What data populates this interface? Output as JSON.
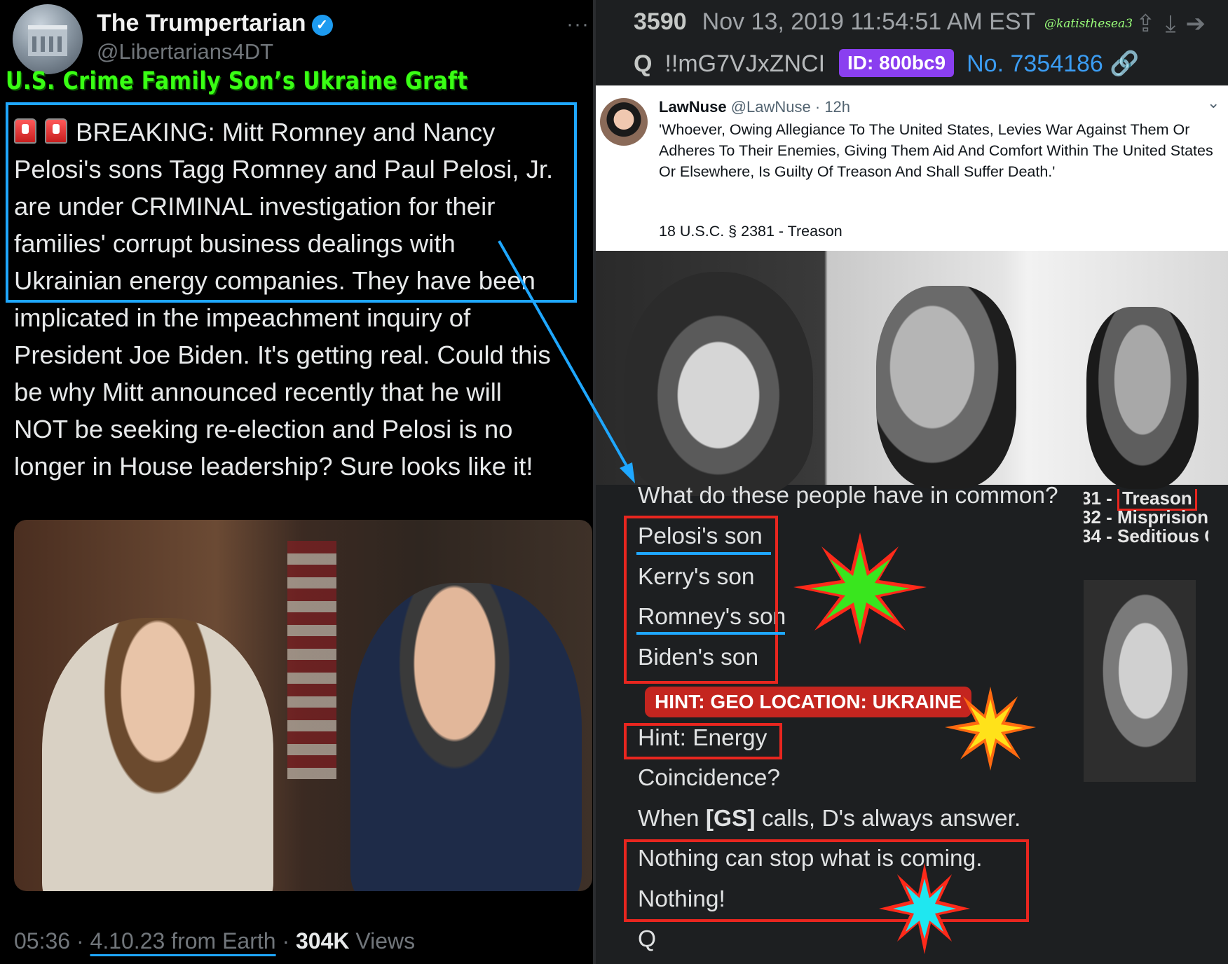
{
  "tweet": {
    "display_name": "The Trumpertarian",
    "verified_glyph": "✓",
    "handle": "@Libertarians4DT",
    "more_glyph": "···",
    "overlay_headline": "U.S. Crime Family Son’s Ukraine Graft",
    "body": "BREAKING: Mitt Romney and Nancy\nPelosi's sons Tagg Romney and Paul Pelosi, Jr.\nare under CRIMINAL investigation for their\nfamilies' corrupt business dealings with\nUkrainian energy companies. They have been\nimplicated in the impeachment inquiry of\nPresident Joe Biden. It's getting real. Could this\nbe why Mitt announced recently that he will\nNOT be seeking re-election and Pelosi is no\nlonger in House leadership? Sure looks like it!",
    "time": "05:36 · ",
    "date_source": "4.10.23 from Earth",
    "views_count": "304K",
    "views_label": " Views",
    "sep": " · "
  },
  "q_post": {
    "number": "3590",
    "timestamp": "Nov 13, 2019 11:54:51 AM EST",
    "watermark": "@katisthesea3",
    "icons": [
      "share-icon",
      "download-icon",
      "forward-icon"
    ],
    "icon_glyphs": "⇪⤓➔",
    "author": "Q",
    "tripcode": "!!mG7VJxZNCI",
    "id_badge": "ID: 800bc9",
    "post_no": "No. 7354186",
    "link_glyph": "🔗",
    "embedded_tweet": {
      "name": "LawNuse",
      "handle_time": "@LawNuse · 12h",
      "text": "'Whoever, Owing Allegiance To The United States, Levies War Against Them Or Adheres To Their Enemies, Giving Them Aid And Comfort Within The United States Or Elsewhere, Is Guilty Of Treason And Shall Suffer Death.'",
      "citation": "18 U.S.C. § 2381 - Treason",
      "chevron": "⌄"
    },
    "lines": {
      "question": "What do these people have in common?",
      "l1": "Pelosi's son",
      "l2": "Kerry's son",
      "l3": "Romney's son",
      "l4": "Biden's son",
      "hint_overlay": "HINT: GEO LOCATION: UKRAINE",
      "l5": "Hint: Energy",
      "l6": "Coincidence?",
      "l7a": "When ",
      "l7b": "[GS]",
      "l7c": " calls, D's always answer.",
      "l8": "Nothing can stop what is coming.",
      "l9": "Nothing!",
      "sig": "Q"
    },
    "law_list": [
      "31 - ",
      "Treason",
      "32 - Misprision",
      "34 - Seditious C"
    ]
  },
  "colors": {
    "highlight_blue": "#1fa7ff",
    "annotation_red": "#e8261f",
    "headline_green": "#39ff14",
    "id_purple": "#8a3ff0",
    "post_link_blue": "#3b9cf2"
  }
}
